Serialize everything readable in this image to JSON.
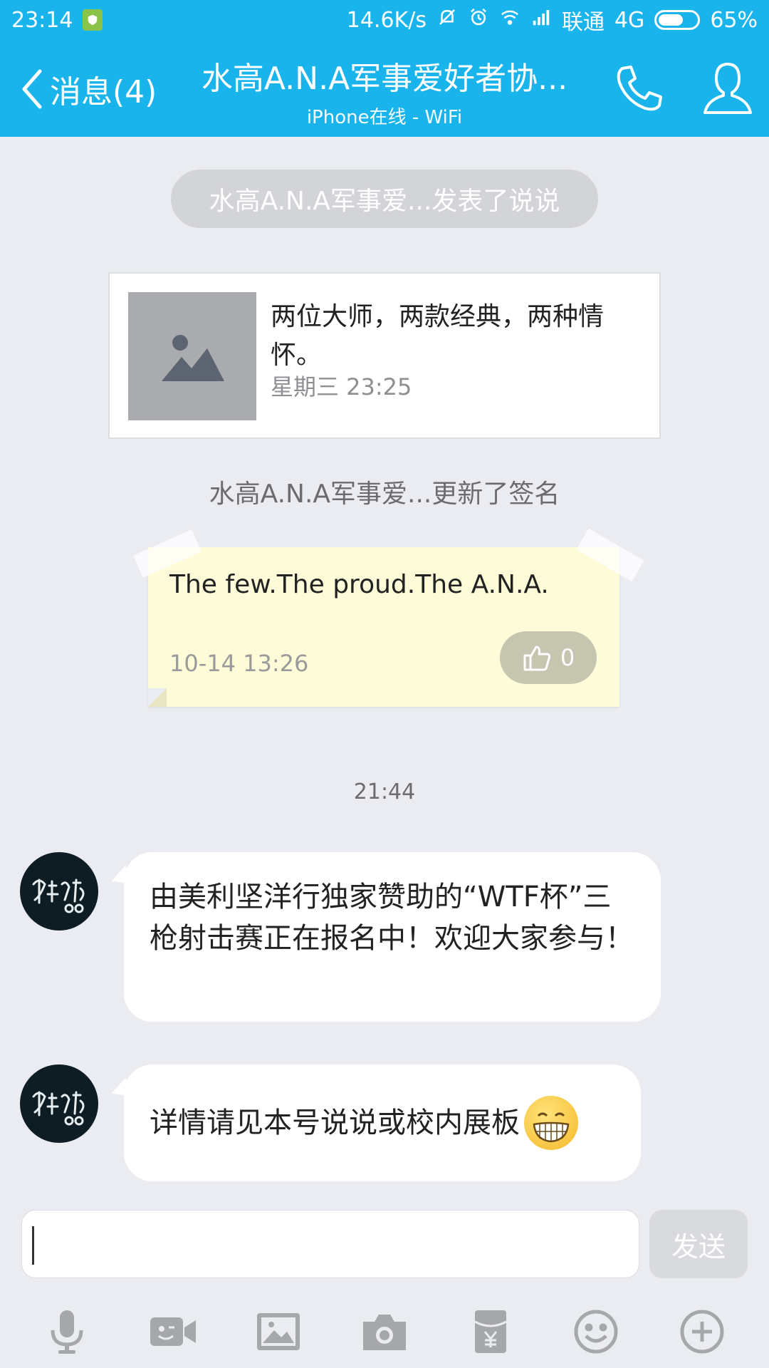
{
  "status_bar": {
    "time": "23:14",
    "net_speed": "14.6K/s",
    "carrier": "联通",
    "network": "4G",
    "battery": "65%",
    "battery_level": 0.65
  },
  "header": {
    "back_label": "消息(4)",
    "title": "水高A.N.A军事爱好者协...",
    "subtitle": "iPhone在线 - WiFi",
    "icons": [
      "phone-icon",
      "profile-icon"
    ]
  },
  "feed": {
    "system_pill": "水高A.N.A军事爱...发表了说说",
    "share_card": {
      "text": "两位大师，两款经典，两种情怀。",
      "date": "星期三 23:25"
    },
    "signature_notice": "水高A.N.A军事爱...更新了签名",
    "signature": {
      "text": "The few.The proud.The A.N.A.",
      "date": "10-14 13:26",
      "likes": "0"
    },
    "timestamp": "21:44",
    "messages": [
      {
        "text": "由美利坚洋行独家赞助的“WTF杯”三枪射击赛正在报名中！欢迎大家参与！"
      },
      {
        "text": "详情请见本号说说或校内展板"
      }
    ]
  },
  "composer": {
    "input_value": "",
    "send_label": "发送"
  },
  "toolbar": [
    "microphone-icon",
    "video-icon",
    "image-icon",
    "camera-icon",
    "red-packet-icon",
    "emoji-icon",
    "plus-icon"
  ],
  "colors": {
    "header": "#19b4ec",
    "background": "#ebecf1",
    "sticky_note": "#fdfbd8"
  }
}
